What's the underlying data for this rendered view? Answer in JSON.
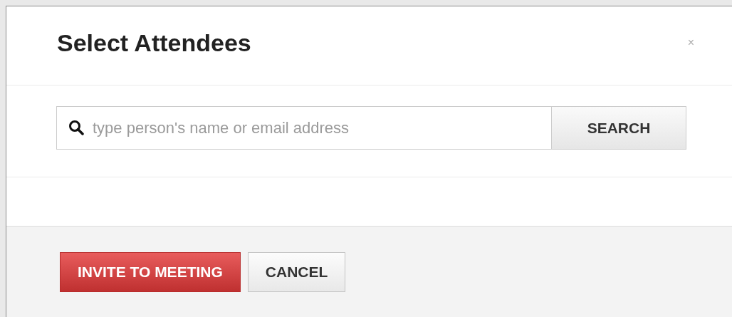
{
  "dialog": {
    "title": "Select Attendees",
    "close": "×"
  },
  "search": {
    "placeholder": "type person's name or email address",
    "button": "SEARCH"
  },
  "buttons": [
    {
      "label": "INVITE TO MEETING",
      "kind": "primary"
    },
    {
      "label": "CANCEL",
      "kind": "default"
    }
  ]
}
